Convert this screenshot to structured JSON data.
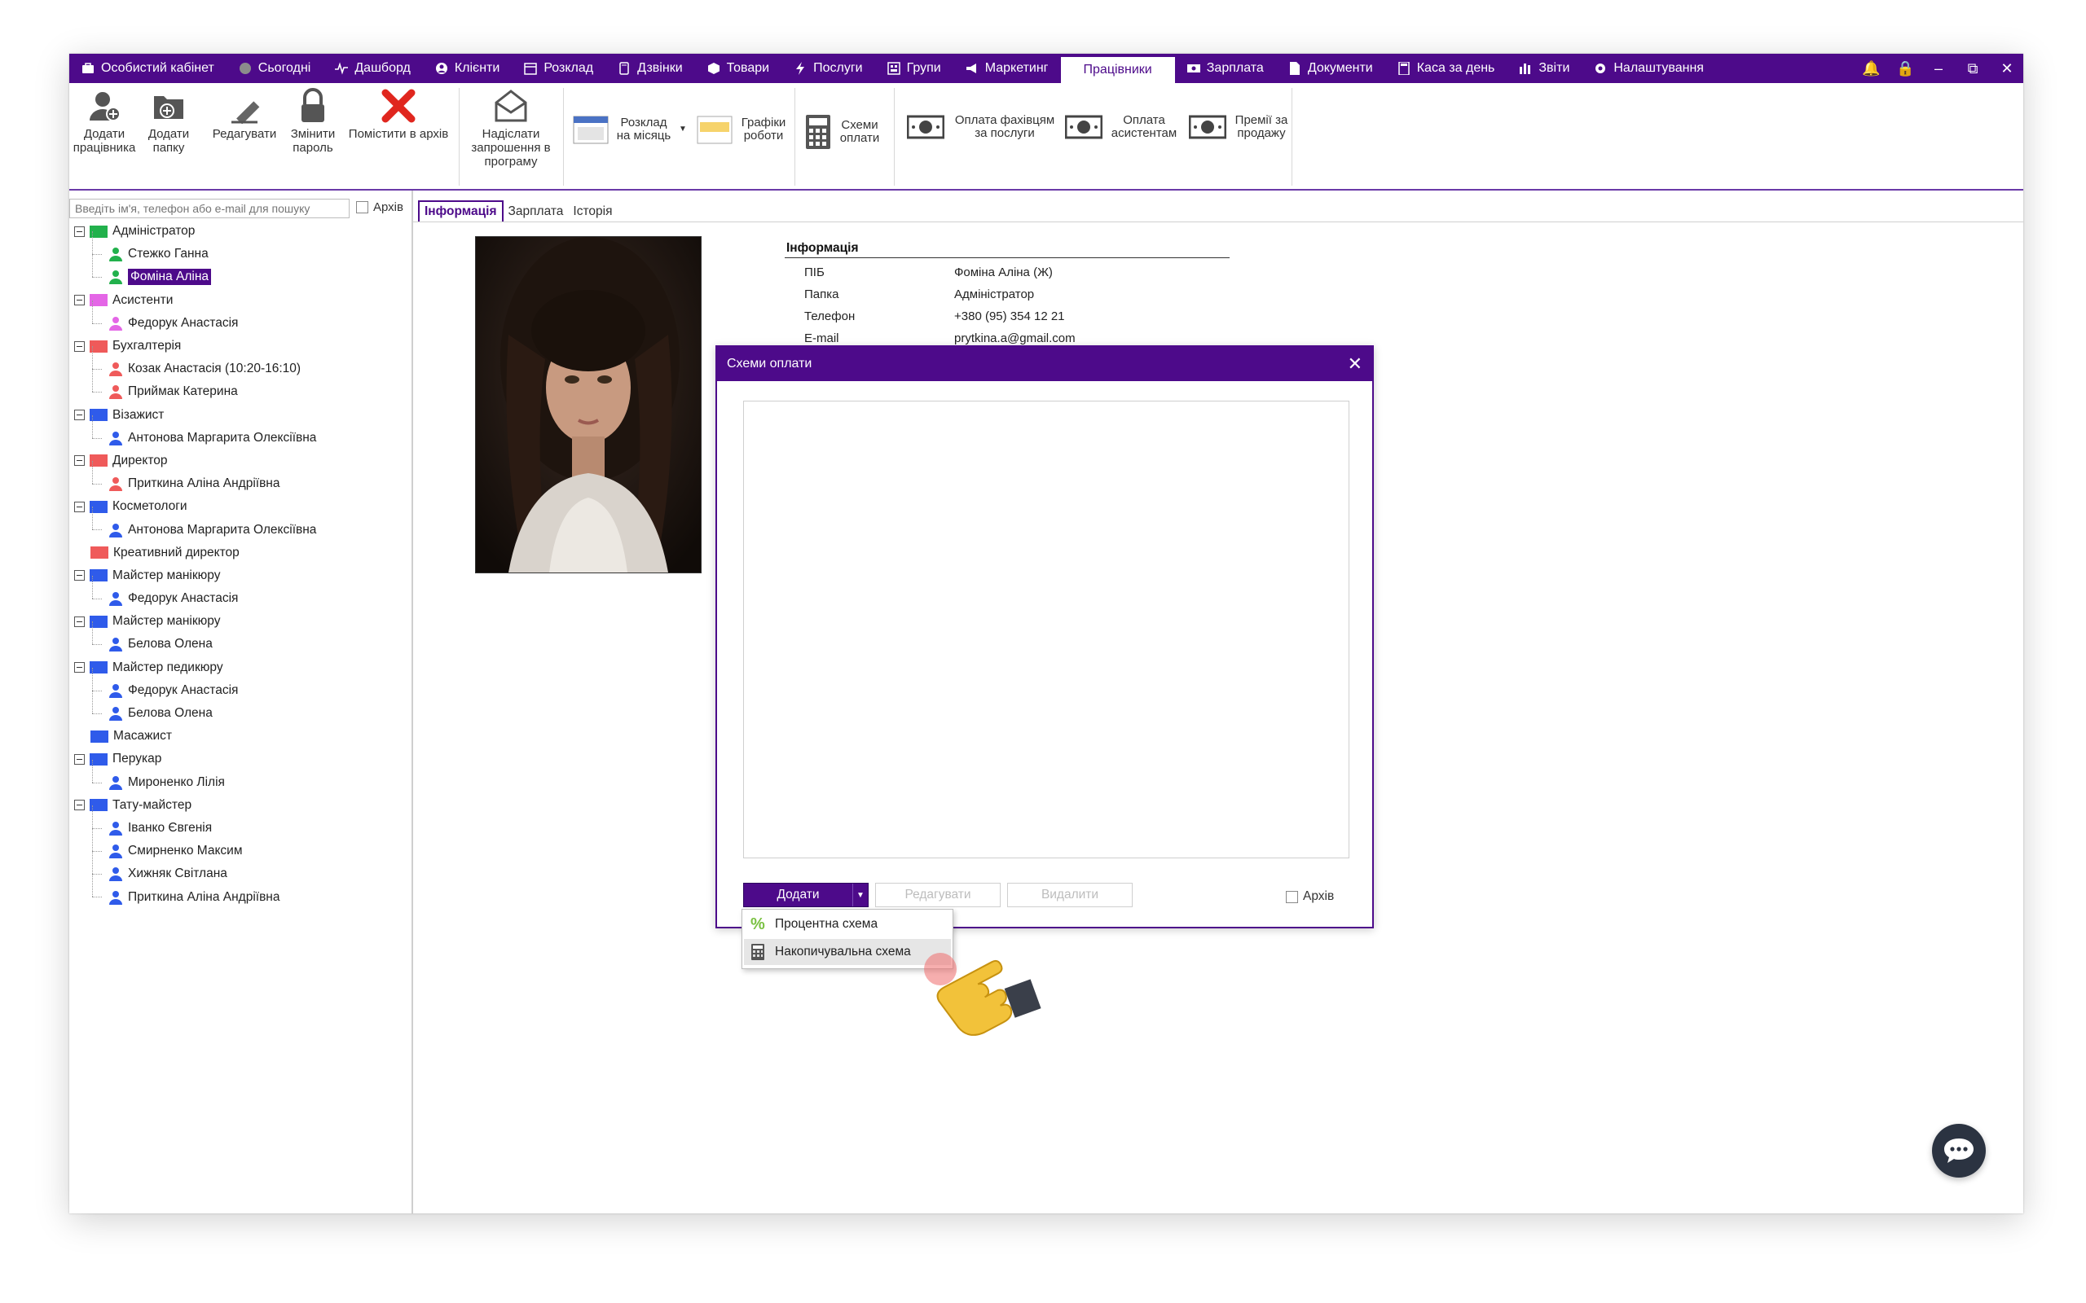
{
  "nav": {
    "items": [
      {
        "label": "Особистий кабінет",
        "icon": "briefcase-icon"
      },
      {
        "label": "Сьогодні",
        "icon": "clock-icon"
      },
      {
        "label": "Дашборд",
        "icon": "pulse-icon"
      },
      {
        "label": "Клієнти",
        "icon": "user-circle-icon"
      },
      {
        "label": "Розклад",
        "icon": "calendar-icon"
      },
      {
        "label": "Дзвінки",
        "icon": "phone-icon"
      },
      {
        "label": "Товари",
        "icon": "box-icon"
      },
      {
        "label": "Послуги",
        "icon": "bolt-icon"
      },
      {
        "label": "Групи",
        "icon": "group-icon"
      },
      {
        "label": "Маркетинг",
        "icon": "megaphone-icon"
      },
      {
        "label": "Працівники",
        "icon": "",
        "active": true
      },
      {
        "label": "Зарплата",
        "icon": "money-icon"
      },
      {
        "label": "Документи",
        "icon": "document-icon"
      },
      {
        "label": "Каса за день",
        "icon": "calculator-icon"
      },
      {
        "label": "Звіти",
        "icon": "bar-chart-icon"
      },
      {
        "label": "Налаштування",
        "icon": "gear-icon"
      }
    ]
  },
  "toolbar": {
    "add_employee": "Додати працівника",
    "add_folder": "Додати папку",
    "edit": "Редагувати",
    "change_password": "Змінити пароль",
    "archive": "Помістити в архів",
    "send_invite": "Надіслати запрошення в програму",
    "monthly_schedule": "Розклад на місяць",
    "work_schedules": "Графіки роботи",
    "payment_schemes": "Схеми оплати",
    "pay_specialists": "Оплата фахівцям за послуги",
    "pay_assistants": "Оплата асистентам",
    "sales_bonuses": "Премії за продажу"
  },
  "sidebar": {
    "search_placeholder": "Введіть ім'я, телефон або e-mail для пошуку",
    "archive_label": "Архів",
    "tree": [
      {
        "type": "folder",
        "label": "Адміністратор",
        "color": "#22b14c",
        "expandable": true
      },
      {
        "type": "person",
        "label": "Стежко Ганна",
        "color": "#22b14c"
      },
      {
        "type": "person",
        "label": "Фоміна Аліна",
        "color": "#22b14c",
        "selected": true
      },
      {
        "type": "folder",
        "label": "Асистенти",
        "color": "#e466e6",
        "expandable": true
      },
      {
        "type": "person",
        "label": "Федорук Анастасія",
        "color": "#e466e6"
      },
      {
        "type": "folder",
        "label": "Бухгалтерія",
        "color": "#ef5a5a",
        "expandable": true
      },
      {
        "type": "person",
        "label": "Козак Анастасія (10:20-16:10)",
        "color": "#ef5a5a"
      },
      {
        "type": "person",
        "label": "Приймак Катерина",
        "color": "#ef5a5a"
      },
      {
        "type": "folder",
        "label": "Візажист",
        "color": "#2f5bea",
        "expandable": true
      },
      {
        "type": "person",
        "label": "Антонова Маргарита Олексіївна",
        "color": "#2f5bea"
      },
      {
        "type": "folder",
        "label": "Директор",
        "color": "#ef5a5a",
        "expandable": true
      },
      {
        "type": "person",
        "label": "Приткина Аліна Андріївна",
        "color": "#ef5a5a"
      },
      {
        "type": "folder",
        "label": "Косметологи",
        "color": "#2f5bea",
        "expandable": true
      },
      {
        "type": "person",
        "label": "Антонова Маргарита Олексіївна",
        "color": "#2f5bea"
      },
      {
        "type": "folder",
        "label": "Креативний директор",
        "color": "#ef5a5a",
        "expandable": false
      },
      {
        "type": "folder",
        "label": "Майстер манікюру",
        "color": "#2f5bea",
        "expandable": true
      },
      {
        "type": "person",
        "label": "Федорук Анастасія",
        "color": "#2f5bea"
      },
      {
        "type": "folder",
        "label": "Майстер манікюру",
        "color": "#2f5bea",
        "expandable": true
      },
      {
        "type": "person",
        "label": "Белова Олена",
        "color": "#2f5bea"
      },
      {
        "type": "folder",
        "label": "Майстер педикюру",
        "color": "#2f5bea",
        "expandable": true
      },
      {
        "type": "person",
        "label": "Федорук Анастасія",
        "color": "#2f5bea"
      },
      {
        "type": "person",
        "label": "Белова Олена",
        "color": "#2f5bea"
      },
      {
        "type": "folder",
        "label": "Масажист",
        "color": "#2f5bea",
        "expandable": false
      },
      {
        "type": "folder",
        "label": "Перукар",
        "color": "#2f5bea",
        "expandable": true
      },
      {
        "type": "person",
        "label": "Мироненко Лілія",
        "color": "#2f5bea"
      },
      {
        "type": "folder",
        "label": "Тату-майстер",
        "color": "#2f5bea",
        "expandable": true
      },
      {
        "type": "person",
        "label": "Іванко Євгенія",
        "color": "#2f5bea"
      },
      {
        "type": "person",
        "label": "Смирненко Максим",
        "color": "#2f5bea"
      },
      {
        "type": "person",
        "label": "Хижняк Світлана",
        "color": "#2f5bea"
      },
      {
        "type": "person",
        "label": "Приткина Аліна Андріївна",
        "color": "#2f5bea"
      }
    ]
  },
  "tabs": {
    "info": "Інформація",
    "salary": "Зарплата",
    "history": "Історія"
  },
  "info": {
    "title": "Інформація",
    "rows": [
      {
        "key": "ПІБ",
        "value": "Фоміна Аліна (Ж)"
      },
      {
        "key": "Папка",
        "value": "Адміністратор"
      },
      {
        "key": "Телефон",
        "value": "+380 (95) 354 12 21"
      },
      {
        "key": "E-mail",
        "value": "prytkina.a@gmail.com"
      }
    ]
  },
  "modal": {
    "title": "Схеми оплати",
    "add": "Додати",
    "edit": "Редагувати",
    "delete": "Видалити",
    "archive": "Архів",
    "dropdown": [
      {
        "label": "Процентна схема",
        "icon": "percent-icon"
      },
      {
        "label": "Накопичувальна схема",
        "icon": "calculator-icon",
        "hovered": true
      }
    ]
  },
  "colors": {
    "brand": "#4d0a8a",
    "chat": "#2b3341"
  }
}
